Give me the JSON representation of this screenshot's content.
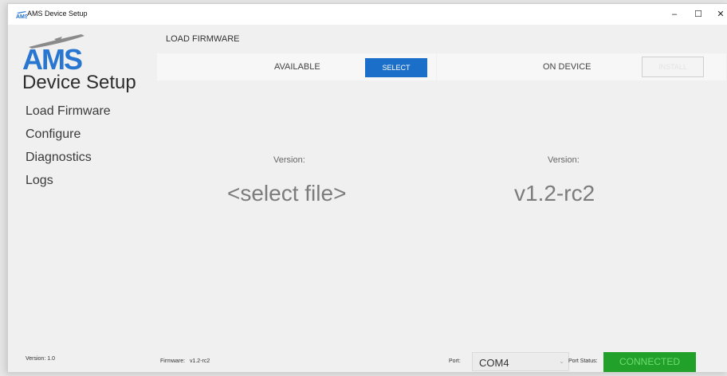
{
  "window": {
    "title": "AMS Device Setup",
    "controls": {
      "minimize": "–",
      "maximize": "☐",
      "close": "✕"
    }
  },
  "sidebar": {
    "logo_text": "AMS",
    "app_name": "Device Setup",
    "items": [
      {
        "label": "Load Firmware"
      },
      {
        "label": "Configure"
      },
      {
        "label": "Diagnostics"
      },
      {
        "label": "Logs"
      }
    ],
    "version_label": "Version:",
    "version_value": "1.0"
  },
  "main": {
    "section_title": "LOAD FIRMWARE",
    "available": {
      "label": "AVAILABLE",
      "select_button": "SELECT",
      "version_label": "Version:",
      "version_value": "<select file>"
    },
    "on_device": {
      "label": "ON DEVICE",
      "install_button": "INSTALL",
      "version_label": "Version:",
      "version_value": "v1.2-rc2"
    }
  },
  "statusbar": {
    "firmware_label": "Firmware:",
    "firmware_value": "v1.2-rc2",
    "port_label": "Port:",
    "port_value": "COM4",
    "port_status_label": "Port Status:",
    "port_status_value": "CONNECTED"
  },
  "colors": {
    "accent": "#1c6fc9",
    "connected": "#21a12a",
    "connected_text": "#6fdc6f",
    "background": "#f0f0f0",
    "panel": "#f7f7f7"
  },
  "icons": {
    "logo": "ams-plane-logo",
    "port_dropdown": "chevron-down-icon"
  }
}
